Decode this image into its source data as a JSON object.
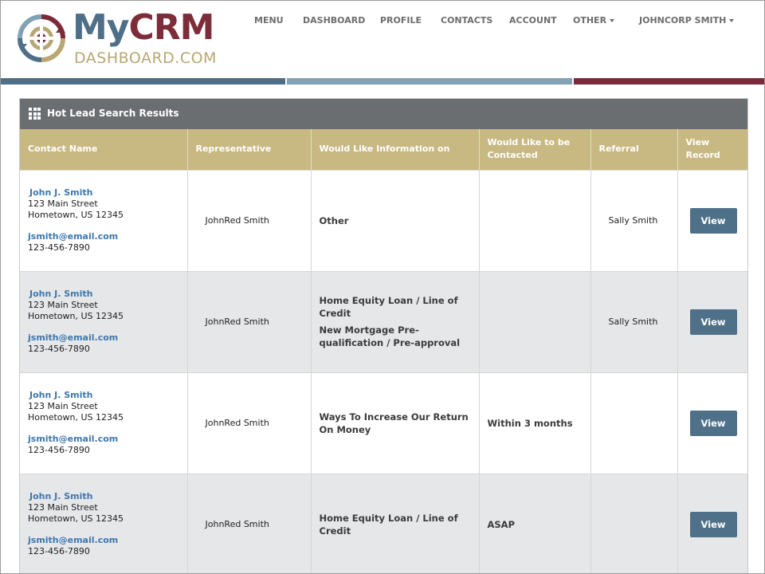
{
  "brand": {
    "name_part1": "My",
    "name_part2": "CRM",
    "subtitle": "DASHBOARD.COM"
  },
  "nav": {
    "items": [
      {
        "label": "MENU"
      },
      {
        "label": "DASHBOARD"
      },
      {
        "label": "PROFILE"
      },
      {
        "label": "CONTACTS"
      },
      {
        "label": "ACCOUNT"
      },
      {
        "label": "OTHER"
      },
      {
        "label": "JOHNCORP SMITH"
      }
    ]
  },
  "colors": {
    "blue": "#4f6f88",
    "light_blue": "#82a2b5",
    "maroon": "#7b2a39",
    "gold": "#c8b882",
    "button": "#4e7189",
    "link": "#3e77ad"
  },
  "panel": {
    "title": "Hot Lead Search Results",
    "icon": "grid-icon"
  },
  "table": {
    "headers": {
      "contact": "Contact Name",
      "rep": "Representative",
      "info": "Would Like Information on",
      "contacted": "Would Like to be Contacted",
      "referral": "Referral",
      "view": "View Record"
    },
    "rows": [
      {
        "name": "John J. Smith",
        "street": "123 Main Street",
        "city": "Hometown, US 12345",
        "email": "jsmith@email.com",
        "phone": "123-456-7890",
        "rep": "JohnRed Smith",
        "info": [
          "Other",
          ""
        ],
        "contacted": "",
        "referral": "Sally Smith",
        "button": "View"
      },
      {
        "name": "John J. Smith",
        "street": "123 Main Street",
        "city": "Hometown, US 12345",
        "email": "jsmith@email.com",
        "phone": "123-456-7890",
        "rep": "JohnRed Smith",
        "info": [
          "Home Equity Loan / Line of Credit",
          "New Mortgage Pre-qualification / Pre-approval"
        ],
        "contacted": "",
        "referral": "Sally Smith",
        "button": "View"
      },
      {
        "name": "John J. Smith",
        "street": "123 Main Street",
        "city": "Hometown, US 12345",
        "email": "jsmith@email.com",
        "phone": "123-456-7890",
        "rep": "JohnRed Smith",
        "info": [
          "Ways To Increase Our Return On Money",
          ""
        ],
        "contacted": "Within 3 months",
        "referral": "",
        "button": "View"
      },
      {
        "name": "John J. Smith",
        "street": "123 Main Street",
        "city": "Hometown, US 12345",
        "email": "jsmith@email.com",
        "phone": "123-456-7890",
        "rep": "JohnRed Smith",
        "info": [
          "Home Equity Loan / Line of Credit",
          ""
        ],
        "contacted": "ASAP",
        "referral": "",
        "button": "View"
      }
    ]
  }
}
